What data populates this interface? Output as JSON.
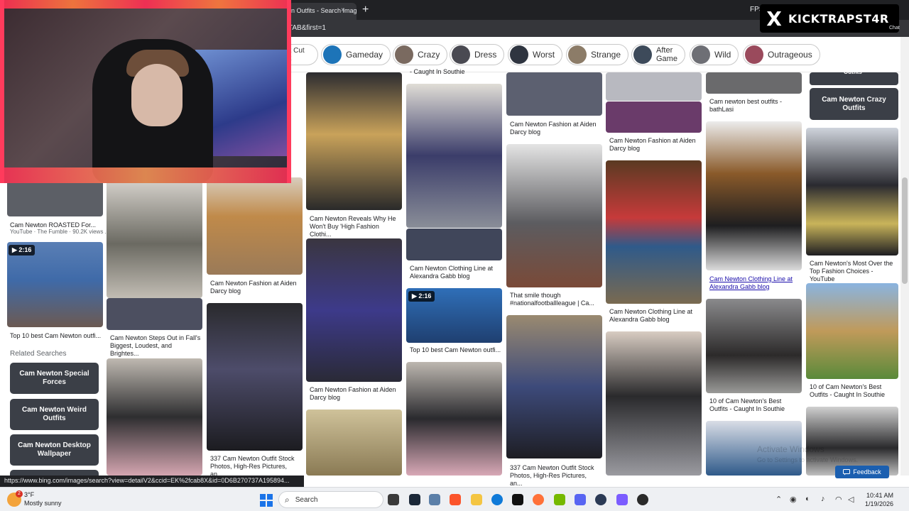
{
  "browser": {
    "tab_title": "n Outfits - Search Images",
    "tab_close": "×",
    "new_tab": "+",
    "fps_label": "FPS",
    "url_fragment": "TAB&first=1",
    "status_url": "https://www.bing.com/images/search?view=detailV2&ccid=EK%2fcab8X&id=0D6B270737A195894..."
  },
  "chips": {
    "partial_label": "at Cut\nut",
    "items": [
      {
        "label": "Gameday"
      },
      {
        "label": "Crazy"
      },
      {
        "label": "Dress"
      },
      {
        "label": "Worst"
      },
      {
        "label": "Strange"
      },
      {
        "label": "After\nGame"
      },
      {
        "label": "Wild"
      },
      {
        "label": "Outrageous"
      }
    ]
  },
  "left": {
    "cards": [
      {
        "caption": "Cam Newton ROASTED For...",
        "sub": "YouTube · The Fumble · 90.2K views ..."
      },
      {
        "badge": "▶ 2:16",
        "caption": "Top 10 best Cam Newton outfi..."
      }
    ],
    "related_heading": "Related Searches",
    "related": [
      {
        "pre": "Cam Newton ",
        "bold": "Special Forces"
      },
      {
        "pre": "Cam Newton ",
        "bold": "Weird Outfits"
      },
      {
        "pre": "Cam Newton ",
        "bold": "Desktop Wallpaper"
      }
    ]
  },
  "grid": {
    "col2": [
      {
        "caption": "Cam Newton Steps Out in Fall's Biggest, Loudest, and Brightes..."
      }
    ],
    "col3": [
      {
        "caption": "Cam Newton Fashion at Aiden Darcy blog"
      },
      {
        "caption": "337 Cam Newton Outfit Stock Photos, High-Res Pictures, an..."
      }
    ],
    "col4": [
      {
        "caption": "Cam Newton Reveals Why He Won't Buy 'High Fashion Clothi..."
      },
      {
        "caption": "Cam Newton Fashion at Aiden Darcy blog"
      }
    ],
    "col5": [
      {
        "caption": "- Caught In Southie"
      },
      {
        "caption": "Cam Newton Clothing Line at Alexandra Gabb blog"
      },
      {
        "badge": "▶ 2:16",
        "caption": "Top 10 best Cam Newton outfi..."
      }
    ],
    "col6": [
      {
        "caption": "Cam Newton Fashion at Aiden Darcy blog"
      },
      {
        "caption": "That smile though #nationalfootballleague | Ca..."
      },
      {
        "caption": "337 Cam Newton Outfit Stock Photos, High-Res Pictures, an..."
      }
    ],
    "col7": [
      {
        "caption": "Cam Newton Fashion at Aiden Darcy blog"
      },
      {
        "caption": "Cam Newton Clothing Line at Alexandra Gabb blog"
      }
    ],
    "col8": [
      {
        "caption": "Cam newton best outfits - bathLasi"
      },
      {
        "caption": "Cam Newton Clothing Line at Alexandra Gabb blog"
      },
      {
        "caption": "10 of Cam Newton's Best Outfits - Caught In Southie"
      }
    ],
    "col9": [
      {
        "caption": "Outfits"
      },
      {
        "pre": "Cam Newton ",
        "bold": "Crazy Outfits"
      },
      {
        "caption": "Cam Newton's Most Over the Top Fashion Choices - YouTube"
      },
      {
        "caption": "10 of Cam Newton's Best Outfits - Caught In Southie"
      }
    ]
  },
  "overlay": {
    "x_logo": "X",
    "handle": "KICKTRAPST4R",
    "chat": "Chat",
    "activate": "Activate Windows",
    "activate_sub": "Go to Settings to activate Windows.",
    "feedback": "Feedback",
    "feedback_icon": "chat-bubble-icon"
  },
  "taskbar": {
    "weather_badge": "2",
    "temp": "3°F",
    "condition": "Mostly sunny",
    "search_placeholder": "Search",
    "time": "10:41 AM",
    "date": "1/19/2026"
  }
}
